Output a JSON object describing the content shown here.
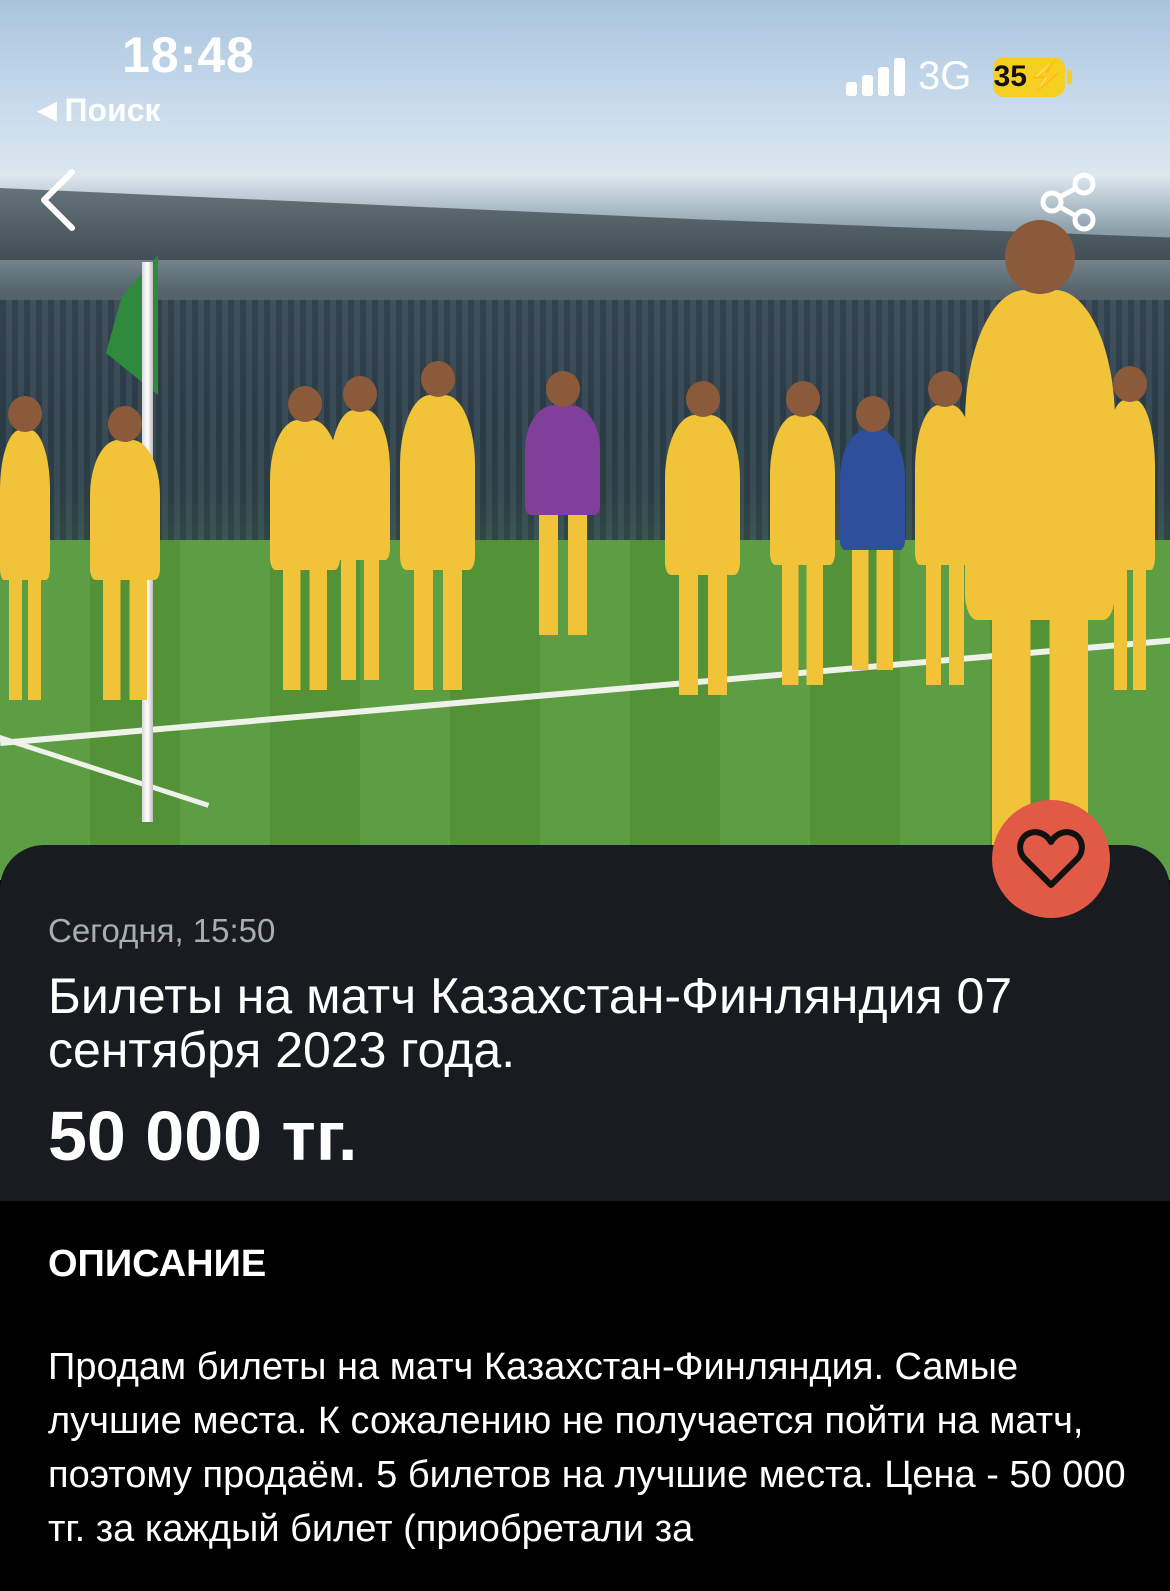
{
  "status_bar": {
    "time": "18:48",
    "back_app_label": "Поиск",
    "network": "3G",
    "battery": "35"
  },
  "hero": {
    "image": "football-team-celebration-photo",
    "icons": {
      "back": "chevron-left-icon",
      "share": "share-icon",
      "favorite": "heart-icon"
    }
  },
  "listing": {
    "date": "Сегодня, 15:50",
    "title": "Билеты на матч Казахстан-Финляндия 07 сентября 2023 года.",
    "price": "50 000 тг."
  },
  "description": {
    "heading": "ОПИСАНИЕ",
    "text": "Продам билеты на матч Казахстан-Финляндия. Самые лучшие места. К сожалению не получается пойти на матч, поэтому продаём. 5 билетов на лучшие места. Цена - 50 000 тг. за каждый билет (приобретали за"
  },
  "colors": {
    "card_bg": "#181c21",
    "favorite_bg": "#e05a45",
    "battery": "#f5d023",
    "page_bg": "#000000"
  }
}
